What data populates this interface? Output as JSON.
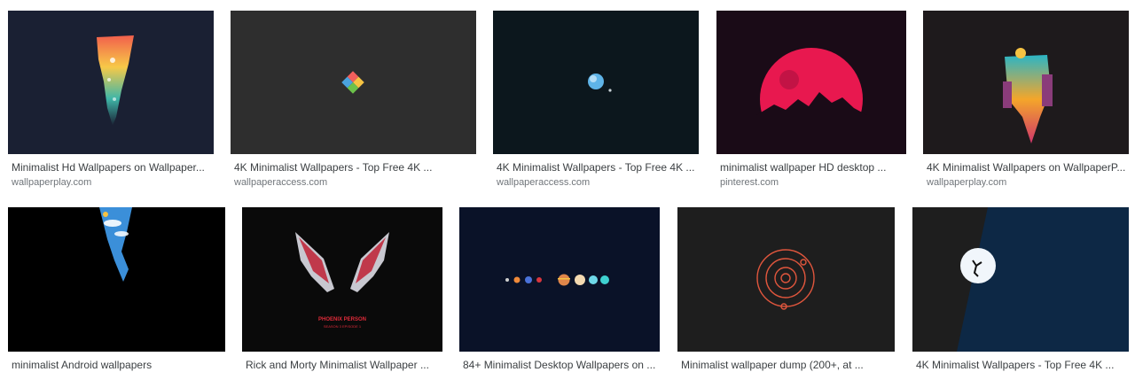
{
  "results": [
    {
      "caption": "Minimalist Hd Wallpapers on Wallpaper...",
      "source": "wallpaperplay.com",
      "bg": "#1a2033",
      "image": "ice-cave-waterfall-art"
    },
    {
      "caption": "4K Minimalist Wallpapers - Top Free 4K ...",
      "source": "wallpaperaccess.com",
      "bg": "#2e2e2e",
      "image": "colorful-diamond-logo"
    },
    {
      "caption": "4K Minimalist Wallpapers - Top Free 4K ...",
      "source": "wallpaperaccess.com",
      "bg": "#0c171d",
      "image": "earth-and-moon"
    },
    {
      "caption": "minimalist wallpaper HD desktop ...",
      "source": "pinterest.com",
      "bg": "#1a0b17",
      "image": "red-planet-mountains"
    },
    {
      "caption": "4K Minimalist Wallpapers on WallpaperP...",
      "source": "wallpaperplay.com",
      "bg": "#1e1a1c",
      "image": "sunset-city-tower"
    },
    {
      "caption": "minimalist Android wallpapers",
      "source": "",
      "bg": "#000000",
      "image": "sky-crack-silhouette"
    },
    {
      "caption": "Rick and Morty Minimalist Wallpaper ...",
      "source": "",
      "bg": "#0a0a0a",
      "image": "striped-wings-emblem",
      "poster_title": "PHOENIX PERSON",
      "poster_sub": "SEASON 3 EPISODE 1"
    },
    {
      "caption": "84+ Minimalist Desktop Wallpapers on ...",
      "source": "",
      "bg": "#0a1228",
      "image": "solar-system-planets-row"
    },
    {
      "caption": "Minimalist wallpaper dump (200+, at ...",
      "source": "",
      "bg": "#1e1e1e",
      "image": "orbit-rings-outline"
    },
    {
      "caption": "4K Minimalist Wallpapers - Top Free 4K ...",
      "source": "",
      "bg": "#0d2845",
      "image": "climber-moon-silhouette"
    }
  ]
}
